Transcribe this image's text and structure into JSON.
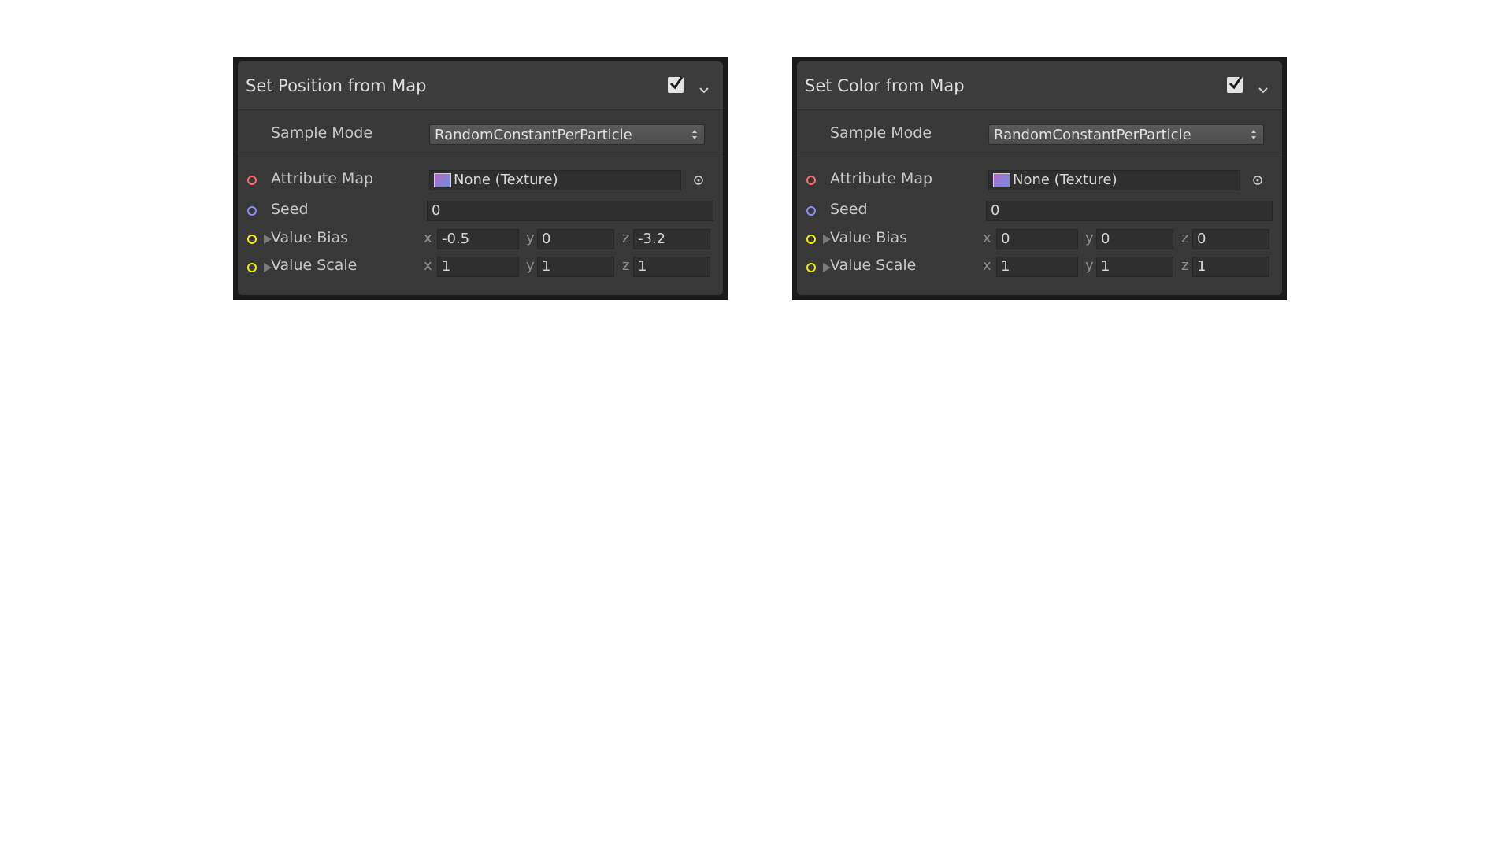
{
  "nodes": [
    {
      "title": "Set Position from Map",
      "sample_mode_label": "Sample Mode",
      "sample_mode_value": "RandomConstantPerParticle",
      "attribute_map_label": "Attribute Map",
      "attribute_map_value": "None (Texture)",
      "seed_label": "Seed",
      "seed_value": "0",
      "value_bias_label": "Value Bias",
      "value_bias": {
        "x": "-0.5",
        "y": "0",
        "z": "-3.2"
      },
      "value_scale_label": "Value Scale",
      "value_scale": {
        "x": "1",
        "y": "1",
        "z": "1"
      }
    },
    {
      "title": "Set Color from Map",
      "sample_mode_label": "Sample Mode",
      "sample_mode_value": "RandomConstantPerParticle",
      "attribute_map_label": "Attribute Map",
      "attribute_map_value": "None (Texture)",
      "seed_label": "Seed",
      "seed_value": "0",
      "value_bias_label": "Value Bias",
      "value_bias": {
        "x": "0",
        "y": "0",
        "z": "0"
      },
      "value_scale_label": "Value Scale",
      "value_scale": {
        "x": "1",
        "y": "1",
        "z": "1"
      }
    }
  ],
  "axis_labels": {
    "x": "x",
    "y": "y",
    "z": "z"
  },
  "colors": {
    "port_texture": "#ff6b6b",
    "port_seed": "#8c8cff",
    "port_vector": "#f0f000"
  },
  "icons": [
    "checkbox-checked-icon",
    "chevron-down-icon",
    "dropdown-arrows-icon",
    "texture-icon",
    "object-picker-icon",
    "expand-triangle-icon"
  ]
}
